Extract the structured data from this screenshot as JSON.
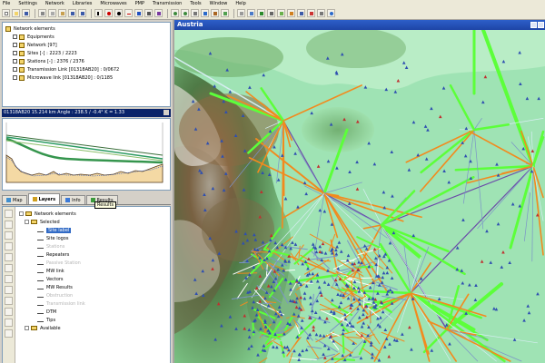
{
  "menu": [
    "File",
    "Settings",
    "Network",
    "Libraries",
    "Microwaves",
    "PMP",
    "Transmission",
    "Tools",
    "Window",
    "Help"
  ],
  "network_tree": {
    "root": "Network elements",
    "items": [
      {
        "label": "Equipments",
        "checked": true
      },
      {
        "label": "Network [97]",
        "checked": true
      },
      {
        "label": "Sites [-] : 2223 / 2223",
        "checked": true
      },
      {
        "label": "Stations [-] : 2376 / 2376",
        "checked": true
      },
      {
        "label": "Transmission Link [01318AB20] : 0/0672",
        "checked": true
      },
      {
        "label": "Microwave link [01318AB20] : 0/1185",
        "checked": true
      }
    ]
  },
  "profile": {
    "title": "01318AB20      15.214 km  Angle : 238.5 / -0.4°  K = 1.33"
  },
  "tabs": [
    {
      "label": "Map",
      "active": false
    },
    {
      "label": "Layers",
      "active": true
    },
    {
      "label": "Info",
      "active": false
    },
    {
      "label": "Results",
      "active": false
    }
  ],
  "tooltip": "Results",
  "layers": {
    "root": "Network elements",
    "selected_group": "Selected",
    "items": [
      {
        "label": "Site label",
        "selected": true,
        "dim": false
      },
      {
        "label": "Site logos",
        "selected": false,
        "dim": false
      },
      {
        "label": "Stations",
        "selected": false,
        "dim": true
      },
      {
        "label": "Repeaters",
        "selected": false,
        "dim": false
      },
      {
        "label": "Passive Station",
        "selected": false,
        "dim": true
      },
      {
        "label": "MW link",
        "selected": false,
        "dim": false
      },
      {
        "label": "Vectors",
        "selected": false,
        "dim": false
      },
      {
        "label": "MW Results",
        "selected": false,
        "dim": false
      },
      {
        "label": "Obstruction",
        "selected": false,
        "dim": true
      },
      {
        "label": "Transmission link",
        "selected": false,
        "dim": true
      },
      {
        "label": "DTM",
        "selected": false,
        "dim": false
      },
      {
        "label": "Tips",
        "selected": false,
        "dim": false
      }
    ],
    "available": "Available"
  },
  "map": {
    "title": "Austria",
    "link_colors": {
      "orange": "#f28a1e",
      "green": "#5cff3a",
      "purple": "#6b4aa8",
      "light": "#d6eef2",
      "blue": "#7b93c8"
    }
  }
}
